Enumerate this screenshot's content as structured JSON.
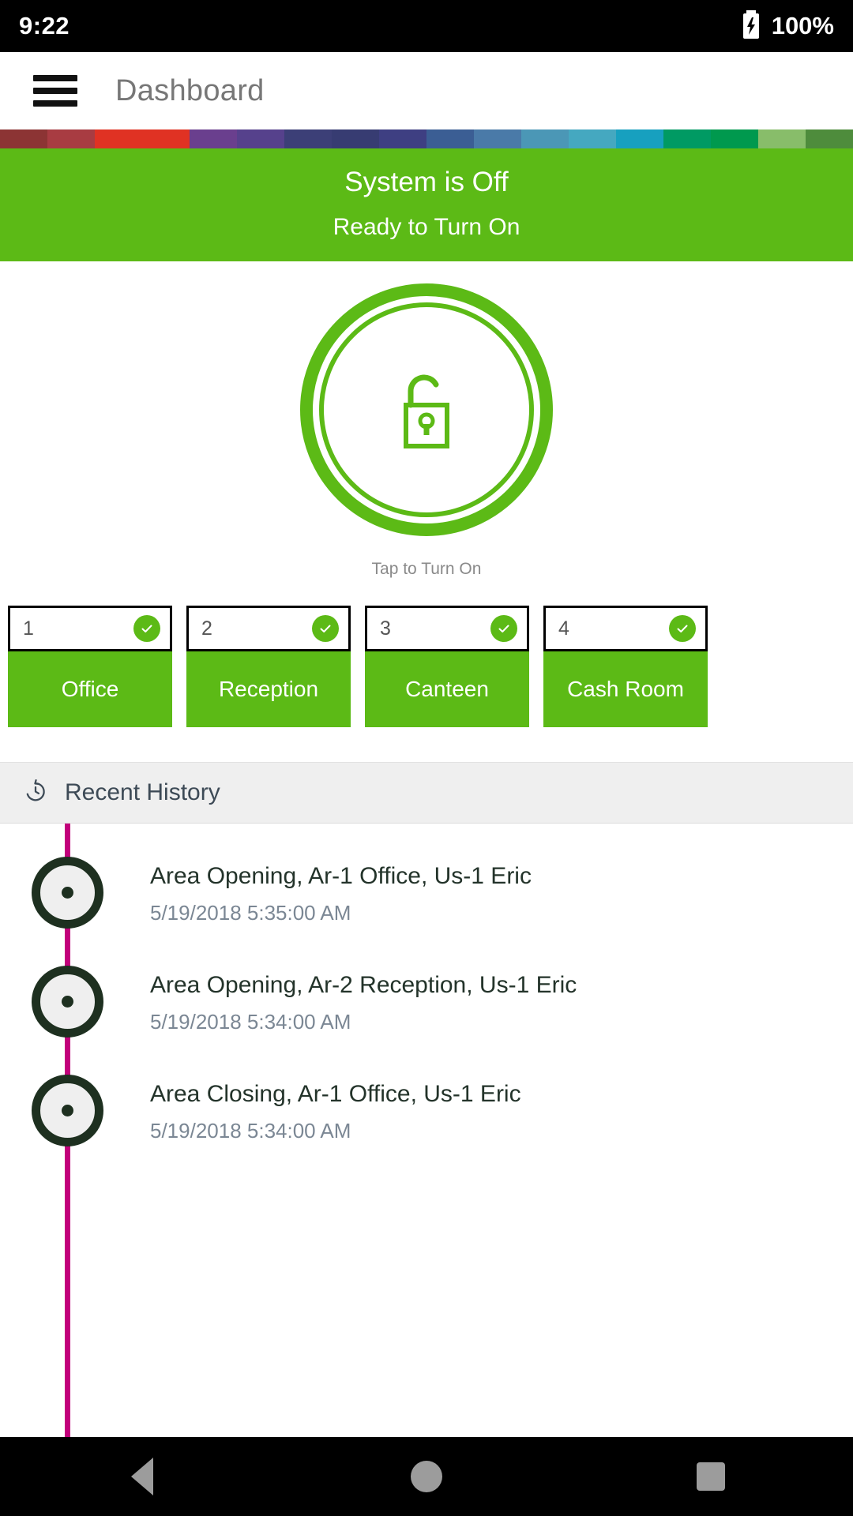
{
  "status_bar": {
    "time": "9:22",
    "battery_percent": "100%",
    "battery_icon": "battery-charging-icon"
  },
  "app_bar": {
    "menu_icon": "hamburger-menu-icon",
    "title": "Dashboard"
  },
  "accent_colors": {
    "green": "#5cba16",
    "timeline_line": "#c2007b",
    "timeline_marker": "#1e3020",
    "history_band": "#efefef"
  },
  "color_stripe": [
    "#8c3434",
    "#a83c42",
    "#e03223",
    "#e03223",
    "#6a3f8e",
    "#56418c",
    "#3c3f77",
    "#373c72",
    "#3e3f82",
    "#3b5e94",
    "#4a7aa8",
    "#4b97b6",
    "#45a8c0",
    "#17a0bf",
    "#009a63",
    "#00994e",
    "#88bd6a",
    "#4e8c3c"
  ],
  "status_banner": {
    "main": "System is Off",
    "sub": "Ready to Turn On"
  },
  "power_button": {
    "icon": "unlocked-padlock-icon",
    "hint": "Tap to Turn On"
  },
  "areas": {
    "tiles": [
      {
        "number": "1",
        "label": "Office",
        "status_icon": "check-circle-icon"
      },
      {
        "number": "2",
        "label": "Reception",
        "status_icon": "check-circle-icon"
      },
      {
        "number": "3",
        "label": "Canteen",
        "status_icon": "check-circle-icon"
      },
      {
        "number": "4",
        "label": "Cash Room",
        "status_icon": "check-circle-icon"
      }
    ]
  },
  "recent_history": {
    "icon": "clock-history-icon",
    "title": "Recent History",
    "entries": [
      {
        "title": "Area Opening, Ar-1 Office, Us-1 Eric",
        "timestamp": "5/19/2018 5:35:00 AM"
      },
      {
        "title": "Area Opening, Ar-2 Reception, Us-1 Eric",
        "timestamp": "5/19/2018 5:34:00 AM"
      },
      {
        "title": "Area Closing, Ar-1 Office, Us-1 Eric",
        "timestamp": "5/19/2018 5:34:00 AM"
      }
    ]
  },
  "nav_bar": {
    "back": "back-icon",
    "home": "home-icon",
    "recents": "recents-icon"
  }
}
